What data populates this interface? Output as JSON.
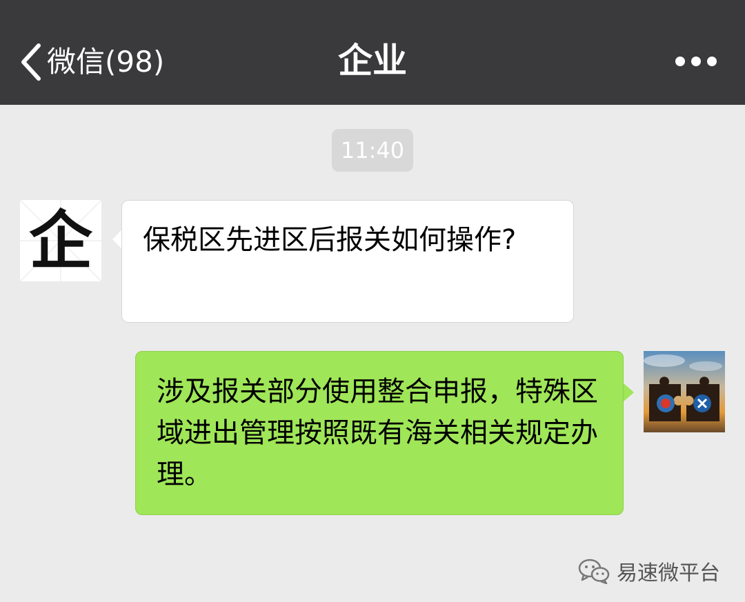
{
  "header": {
    "back_label": "微信(98)",
    "title": "企业",
    "more_icon": "more-dots-icon"
  },
  "timestamp": "11:40",
  "messages": [
    {
      "side": "received",
      "avatar_char": "企",
      "text": "保税区先进区后报关如何操作?"
    },
    {
      "side": "sent",
      "avatar": "puzzle-logo-avatar",
      "text": "涉及报关部分使用整合申报，特殊区域进出管理按照既有海关相关规定办理。"
    }
  ],
  "watermark": {
    "label": "易速微平台",
    "icon": "wechat-icon"
  },
  "colors": {
    "nav_bg": "#3a3a3c",
    "chat_bg": "#ebebeb",
    "sent_bubble": "#9fe658",
    "received_bubble": "#ffffff",
    "time_badge": "#d8d8d8"
  }
}
